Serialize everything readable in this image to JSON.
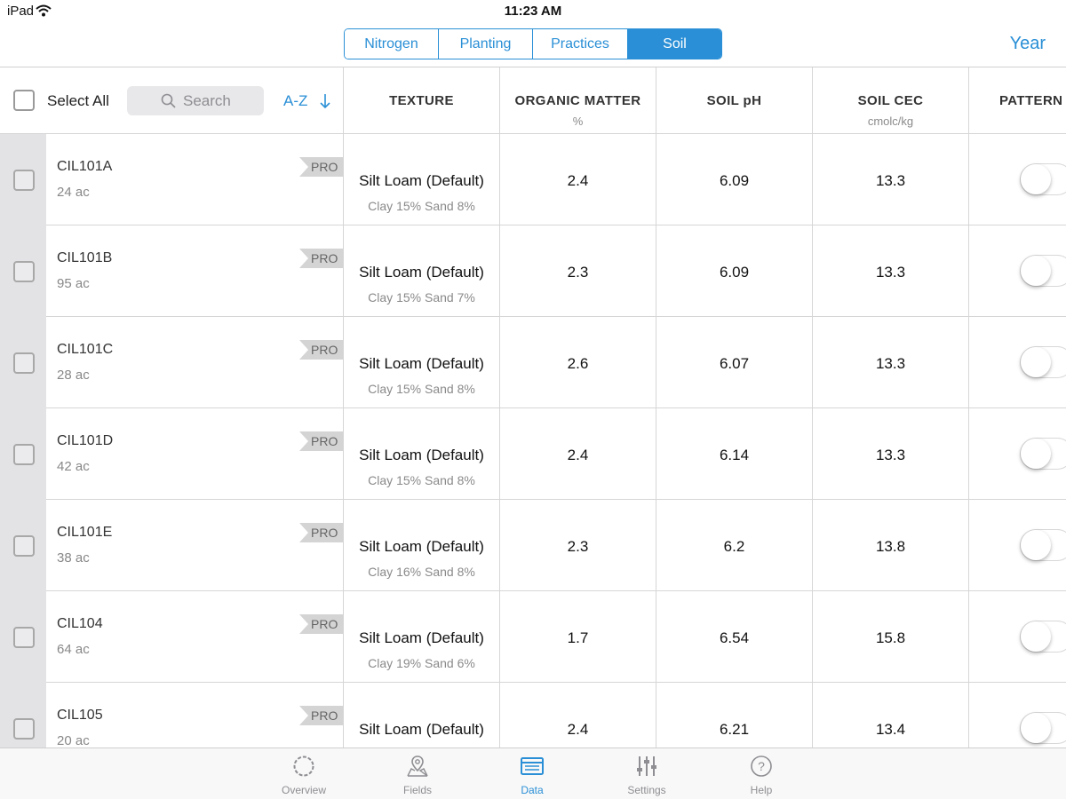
{
  "status_bar": {
    "device": "iPad",
    "time": "11:23 AM"
  },
  "segments": [
    {
      "label": "Nitrogen",
      "active": false
    },
    {
      "label": "Planting",
      "active": false
    },
    {
      "label": "Practices",
      "active": false
    },
    {
      "label": "Soil",
      "active": true
    }
  ],
  "year_label": "Year",
  "list_header": {
    "select_all_label": "Select All",
    "search_placeholder": "Search",
    "sort_label": "A-Z",
    "sort_icon": "arrow-down-icon"
  },
  "columns": [
    {
      "title": "TEXTURE",
      "unit": ""
    },
    {
      "title": "ORGANIC MATTER",
      "unit": "%"
    },
    {
      "title": "SOIL pH",
      "unit": ""
    },
    {
      "title": "SOIL CEC",
      "unit": "cmolc/kg"
    },
    {
      "title": "PATTERN T",
      "unit": ""
    }
  ],
  "rows": [
    {
      "name": "CIL101A",
      "acres": "24 ac",
      "badge": "PRO",
      "texture": "Silt Loam (Default)",
      "texture_detail": "Clay 15% Sand 8%",
      "organic_matter": "2.4",
      "soil_ph": "6.09",
      "soil_cec": "13.3",
      "pattern_tiled": false
    },
    {
      "name": "CIL101B",
      "acres": "95 ac",
      "badge": "PRO",
      "texture": "Silt Loam (Default)",
      "texture_detail": "Clay 15% Sand 7%",
      "organic_matter": "2.3",
      "soil_ph": "6.09",
      "soil_cec": "13.3",
      "pattern_tiled": false
    },
    {
      "name": "CIL101C",
      "acres": "28 ac",
      "badge": "PRO",
      "texture": "Silt Loam (Default)",
      "texture_detail": "Clay 15% Sand 8%",
      "organic_matter": "2.6",
      "soil_ph": "6.07",
      "soil_cec": "13.3",
      "pattern_tiled": false
    },
    {
      "name": "CIL101D",
      "acres": "42 ac",
      "badge": "PRO",
      "texture": "Silt Loam (Default)",
      "texture_detail": "Clay 15% Sand 8%",
      "organic_matter": "2.4",
      "soil_ph": "6.14",
      "soil_cec": "13.3",
      "pattern_tiled": false
    },
    {
      "name": "CIL101E",
      "acres": "38 ac",
      "badge": "PRO",
      "texture": "Silt Loam (Default)",
      "texture_detail": "Clay 16% Sand 8%",
      "organic_matter": "2.3",
      "soil_ph": "6.2",
      "soil_cec": "13.8",
      "pattern_tiled": false
    },
    {
      "name": "CIL104",
      "acres": "64 ac",
      "badge": "PRO",
      "texture": "Silt Loam (Default)",
      "texture_detail": "Clay 19% Sand 6%",
      "organic_matter": "1.7",
      "soil_ph": "6.54",
      "soil_cec": "15.8",
      "pattern_tiled": false
    },
    {
      "name": "CIL105",
      "acres": "20 ac",
      "badge": "PRO",
      "texture": "Silt Loam (Default)",
      "texture_detail": "",
      "organic_matter": "2.4",
      "soil_ph": "6.21",
      "soil_cec": "13.4",
      "pattern_tiled": false
    }
  ],
  "tabs": [
    {
      "label": "Overview",
      "icon": "overview-icon",
      "active": false
    },
    {
      "label": "Fields",
      "icon": "fields-icon",
      "active": false
    },
    {
      "label": "Data",
      "icon": "data-icon",
      "active": true
    },
    {
      "label": "Settings",
      "icon": "settings-icon",
      "active": false
    },
    {
      "label": "Help",
      "icon": "help-icon",
      "active": false
    }
  ],
  "colors": {
    "accent": "#2a8fd6",
    "gutter": "#e3e3e6",
    "badge": "#d4d4d4"
  }
}
